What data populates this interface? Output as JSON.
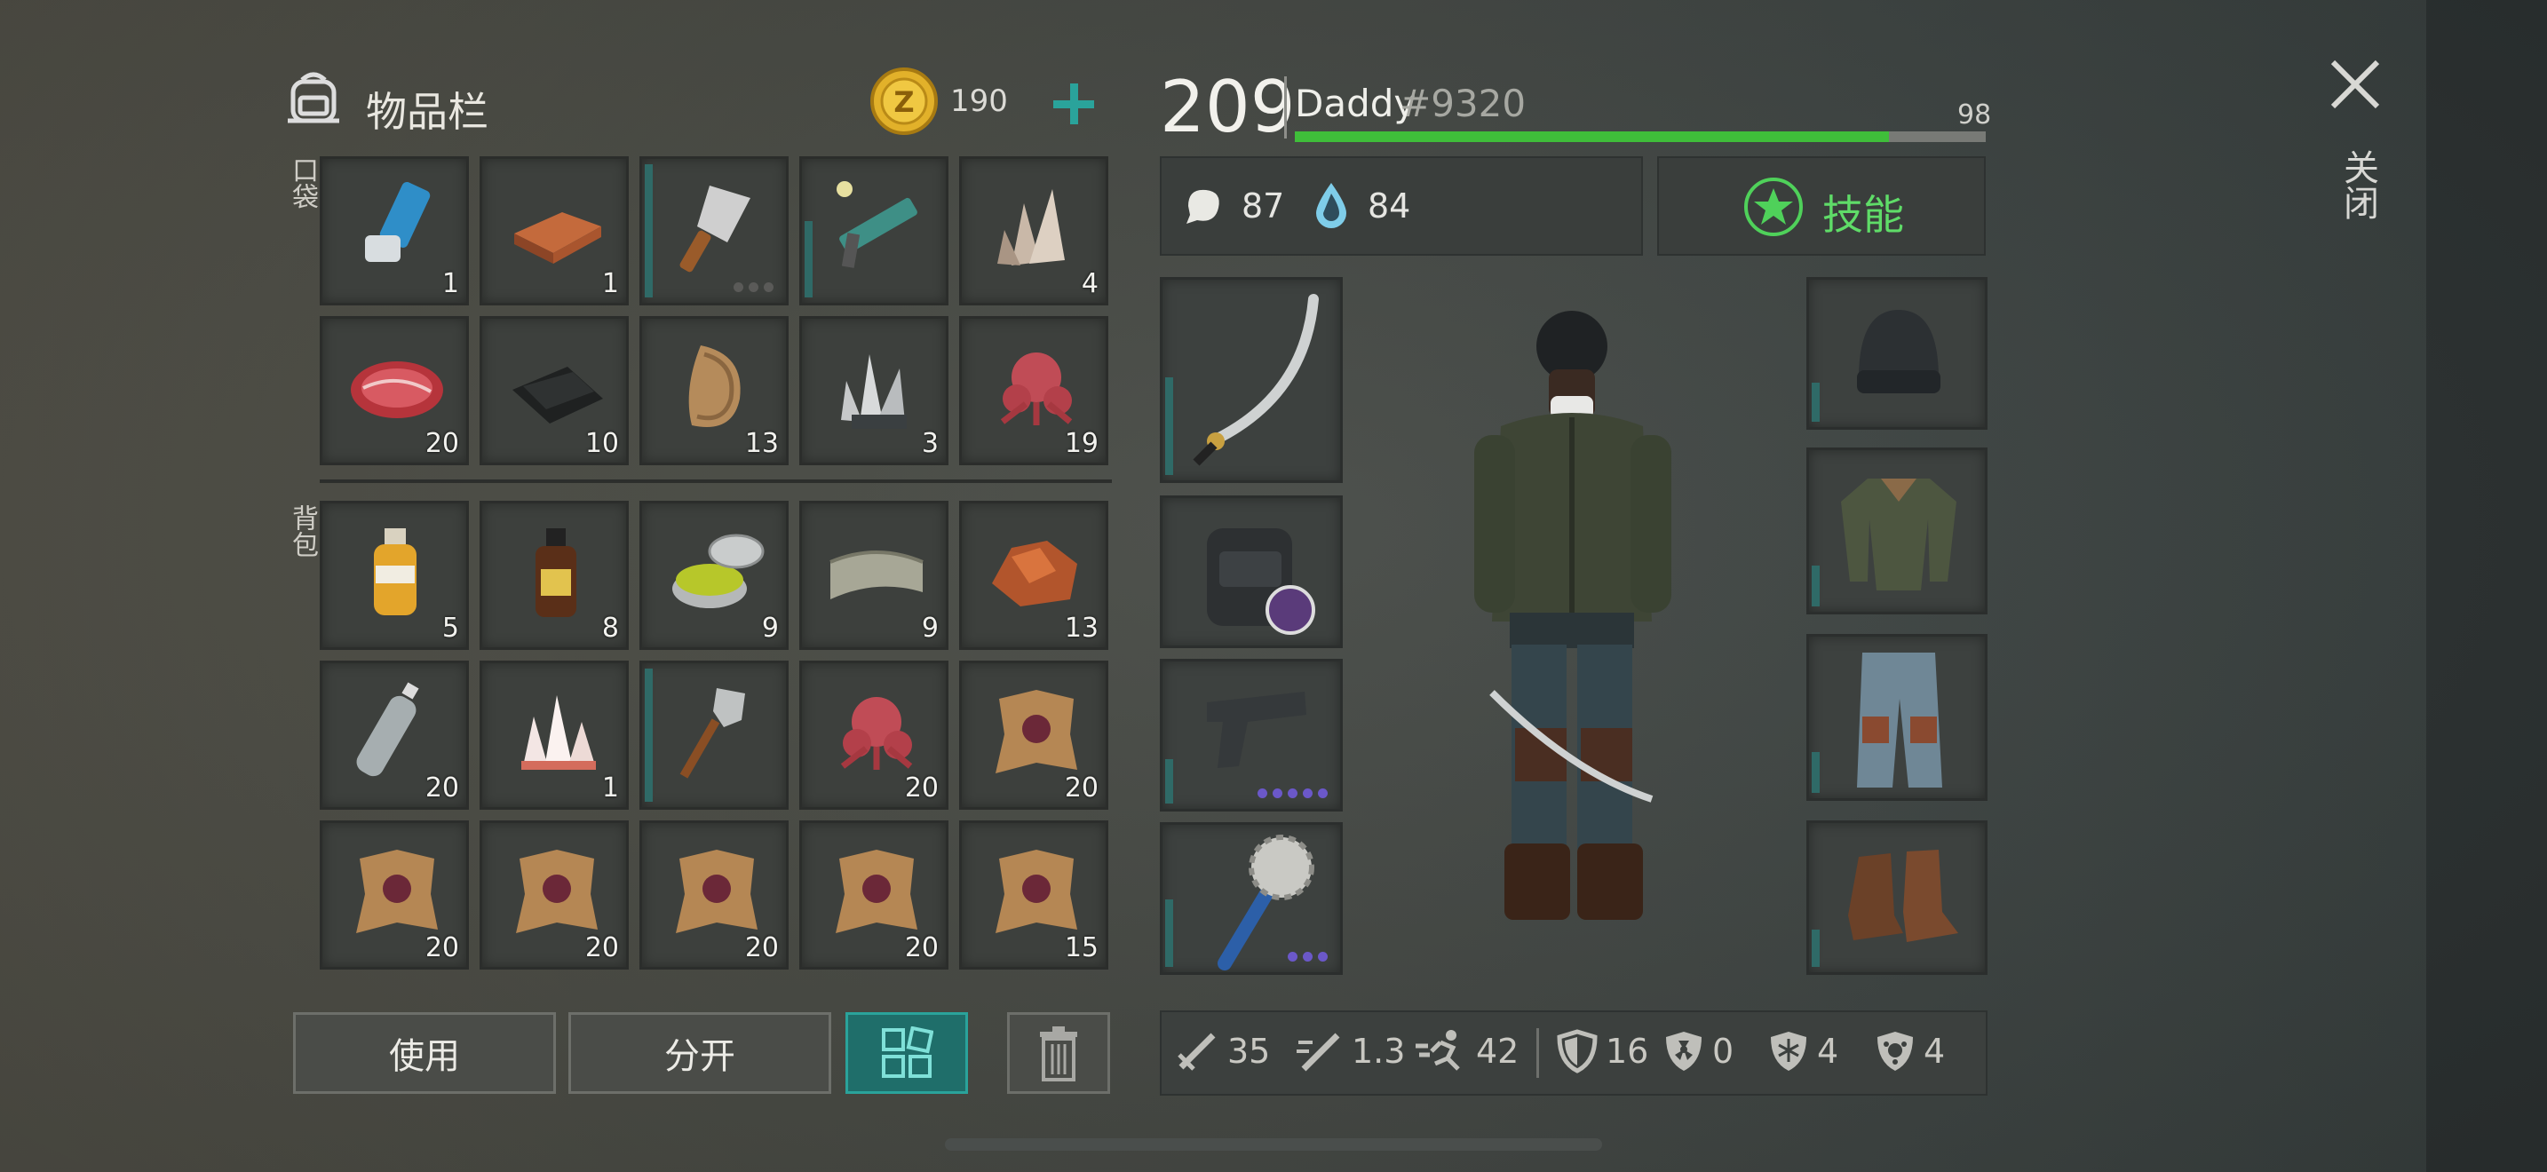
{
  "header": {
    "title": "物品栏",
    "coins": "190",
    "add_label": "+"
  },
  "sections": {
    "pockets": "口袋",
    "backpack": "背包"
  },
  "pocket_slots": [
    {
      "item": "inhaler",
      "count": "1"
    },
    {
      "item": "copper-ingot",
      "count": "1"
    },
    {
      "item": "cleaver",
      "count": ""
    },
    {
      "item": "plasma-rifle",
      "count": ""
    },
    {
      "item": "quartz-crystal",
      "count": "4"
    },
    {
      "item": "raw-meat",
      "count": "20"
    },
    {
      "item": "black-fabric",
      "count": "10"
    },
    {
      "item": "fur",
      "count": "13"
    },
    {
      "item": "metal-crystals",
      "count": "3"
    },
    {
      "item": "mushroom-creature",
      "count": "19"
    }
  ],
  "backpack_slots": [
    {
      "item": "pesticide-bottle",
      "count": "5"
    },
    {
      "item": "iodine-bottle",
      "count": "8"
    },
    {
      "item": "salve-tin",
      "count": "9"
    },
    {
      "item": "leather-roll",
      "count": "9"
    },
    {
      "item": "copper-ore",
      "count": "13"
    },
    {
      "item": "water-bottle",
      "count": "20"
    },
    {
      "item": "salt-crystals",
      "count": "1"
    },
    {
      "item": "shovel",
      "count": ""
    },
    {
      "item": "mushroom-creature",
      "count": "20"
    },
    {
      "item": "infected-hide",
      "count": "20"
    },
    {
      "item": "infected-hide",
      "count": "20"
    },
    {
      "item": "infected-hide",
      "count": "20"
    },
    {
      "item": "infected-hide",
      "count": "20"
    },
    {
      "item": "infected-hide",
      "count": "20"
    },
    {
      "item": "infected-hide",
      "count": "15"
    }
  ],
  "buttons": {
    "use": "使用",
    "split": "分开"
  },
  "player": {
    "level": "209",
    "name": "Daddy",
    "tag": "#9320",
    "health": "98",
    "health_fraction": 0.86,
    "hunger": "87",
    "thirst": "84",
    "skills": "技能"
  },
  "stats": {
    "attack": "35",
    "attack_speed": "1.3",
    "speed": "42",
    "armor": "16",
    "radiation": "0",
    "cold": "4",
    "infection": "4"
  },
  "close": "关闭",
  "colors": {
    "accent_teal": "#2a8c86",
    "health_green": "#3fbe3a",
    "coin_gold": "#e2b12a",
    "skill_green": "#4fd15a"
  }
}
